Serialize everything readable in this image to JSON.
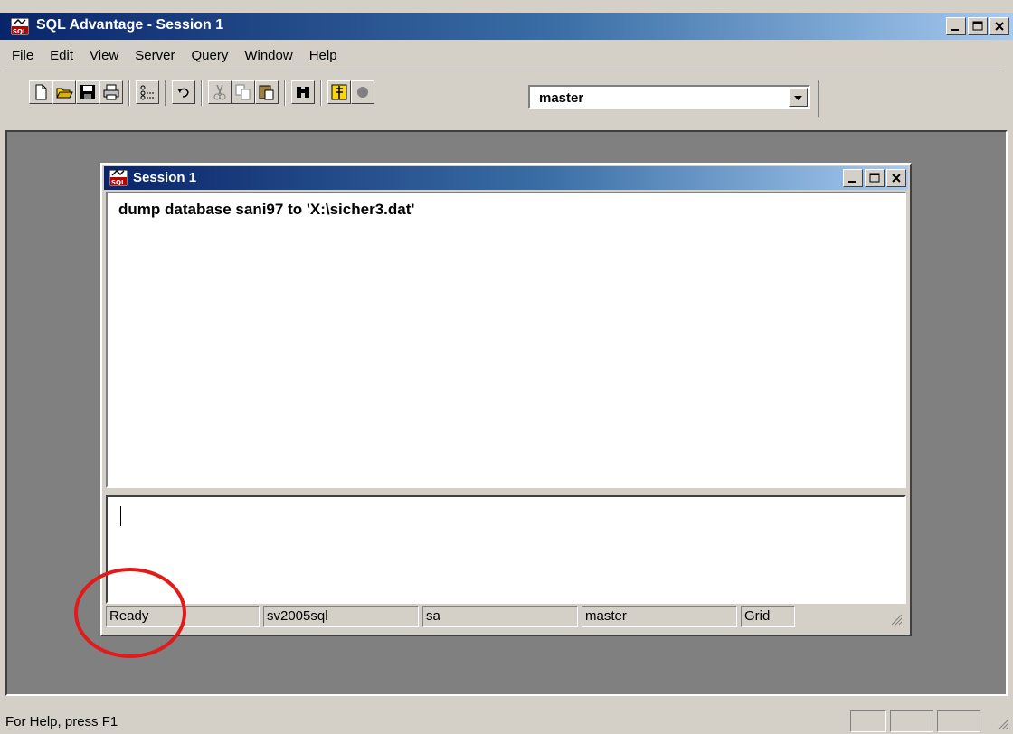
{
  "window": {
    "title": "SQL Advantage - Session 1"
  },
  "menu": [
    "File",
    "Edit",
    "View",
    "Server",
    "Query",
    "Window",
    "Help"
  ],
  "toolbar": {
    "database_selected": "master"
  },
  "session": {
    "title": "Session 1",
    "query_text": "dump database sani97 to 'X:\\sicher3.dat'",
    "status": {
      "state": "Ready",
      "server": "sv2005sql",
      "user": "sa",
      "database": "master",
      "mode": "Grid"
    }
  },
  "statusbar": {
    "help_text": "For Help, press F1"
  },
  "annotation": {
    "highlight_color": "#e31a1a"
  }
}
